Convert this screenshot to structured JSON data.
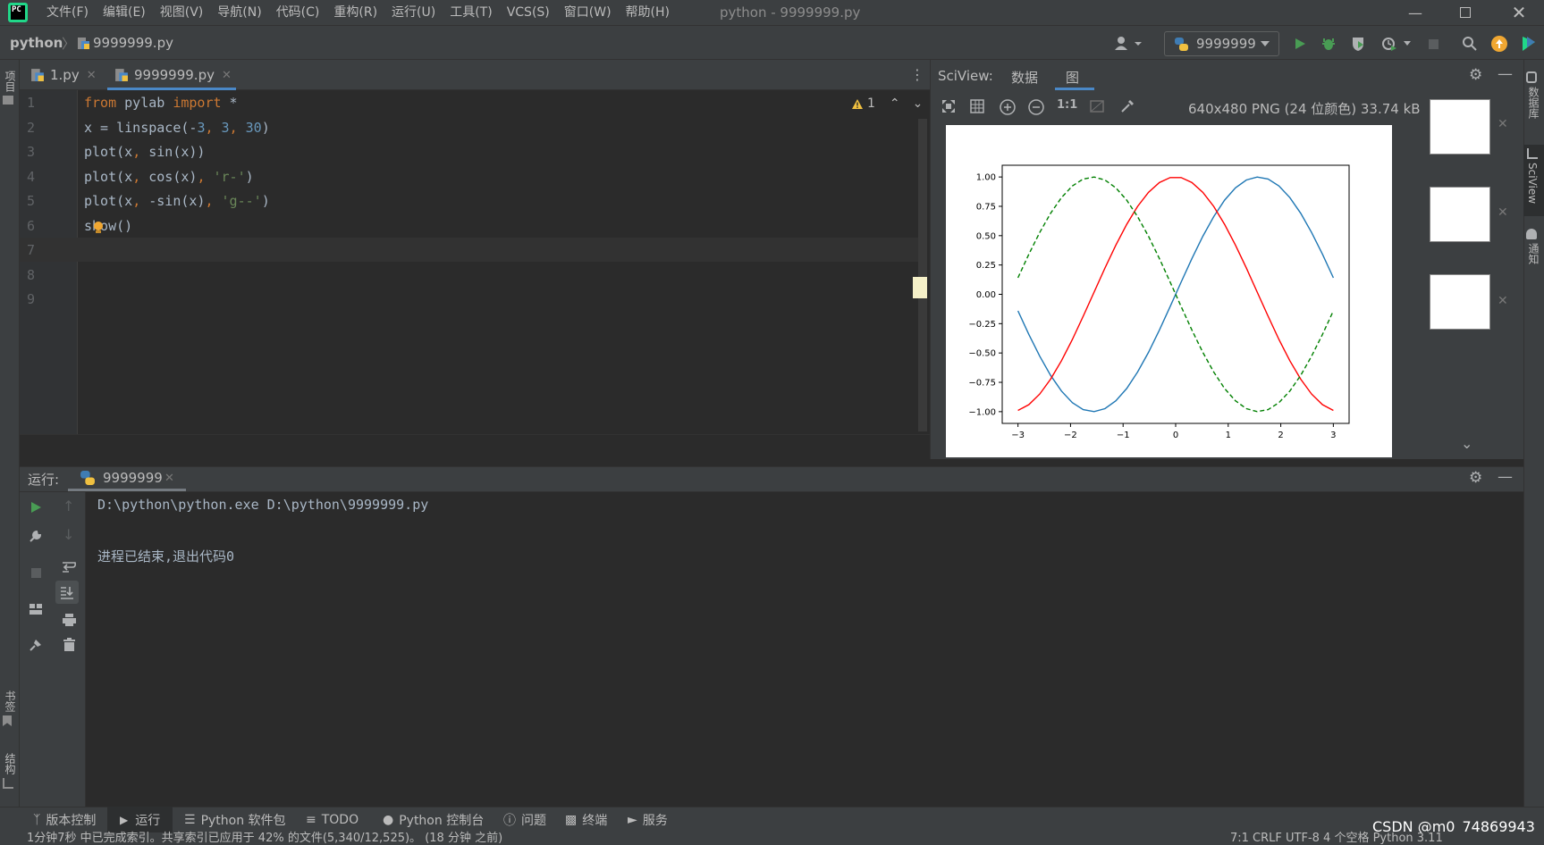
{
  "titlebar": {
    "menu": [
      "文件(F)",
      "编辑(E)",
      "视图(V)",
      "导航(N)",
      "代码(C)",
      "重构(R)",
      "运行(U)",
      "工具(T)",
      "VCS(S)",
      "窗口(W)",
      "帮助(H)"
    ],
    "title": "python - 9999999.py",
    "logo_text": "PC"
  },
  "navbar": {
    "project": "python",
    "file": "9999999.py",
    "run_config": "9999999"
  },
  "left_strip": {
    "project": "项目",
    "bookmarks": "书签",
    "structure": "结构"
  },
  "right_strip": {
    "database": "数据库",
    "sciview": "SciView",
    "notifications": "通知"
  },
  "editor": {
    "tabs": [
      {
        "label": "1.py",
        "active": false
      },
      {
        "label": "9999999.py",
        "active": true
      }
    ],
    "warning_count": "1",
    "line_numbers": [
      "1",
      "2",
      "3",
      "4",
      "5",
      "6",
      "7",
      "8",
      "9"
    ],
    "lines": [
      [
        {
          "t": "from",
          "c": "kw"
        },
        {
          "t": " pylab ",
          "c": "fn"
        },
        {
          "t": "import",
          "c": "kw"
        },
        {
          "t": " *",
          "c": "fn"
        }
      ],
      [
        {
          "t": "x = linspace(-",
          "c": "fn"
        },
        {
          "t": "3",
          "c": "num"
        },
        {
          "t": ", ",
          "c": "kw"
        },
        {
          "t": "3",
          "c": "num"
        },
        {
          "t": ", ",
          "c": "kw"
        },
        {
          "t": "30",
          "c": "num"
        },
        {
          "t": ")",
          "c": "fn"
        }
      ],
      [
        {
          "t": "plot(x",
          "c": "fn"
        },
        {
          "t": ", ",
          "c": "kw"
        },
        {
          "t": "sin(x))",
          "c": "fn"
        }
      ],
      [
        {
          "t": "plot(x",
          "c": "fn"
        },
        {
          "t": ", ",
          "c": "kw"
        },
        {
          "t": "cos(x)",
          "c": "fn"
        },
        {
          "t": ", ",
          "c": "kw"
        },
        {
          "t": "'r-'",
          "c": "str"
        },
        {
          "t": ")",
          "c": "fn"
        }
      ],
      [
        {
          "t": "plot(x",
          "c": "fn"
        },
        {
          "t": ", ",
          "c": "kw"
        },
        {
          "t": "-sin(x)",
          "c": "fn"
        },
        {
          "t": ", ",
          "c": "kw"
        },
        {
          "t": "'g--'",
          "c": "str"
        },
        {
          "t": ")",
          "c": "fn"
        }
      ],
      [
        {
          "t": "show()",
          "c": "fn"
        }
      ],
      [],
      [],
      []
    ]
  },
  "sciview": {
    "title": "SciView:",
    "tabs": [
      "数据",
      "图"
    ],
    "image_info": "640x480 PNG (24 位颜色) 33.74 kB",
    "zoom_label": "1:1"
  },
  "chart_data": {
    "type": "line",
    "title": "",
    "xlabel": "",
    "ylabel": "",
    "xlim": [
      -3.3,
      3.3
    ],
    "ylim": [
      -1.1,
      1.1
    ],
    "xticks": [
      "−3",
      "−2",
      "−1",
      "0",
      "1",
      "2",
      "3"
    ],
    "yticks": [
      "−1.00",
      "−0.75",
      "−0.50",
      "−0.25",
      "0.00",
      "0.25",
      "0.50",
      "0.75",
      "1.00"
    ],
    "x": "linspace(-3, 3, 30)",
    "series": [
      {
        "fn": "sin",
        "color": "#1f77b4",
        "style": "solid"
      },
      {
        "fn": "cos",
        "color": "#ff0000",
        "style": "solid"
      },
      {
        "fn": "-sin",
        "color": "#008000",
        "style": "dashed"
      }
    ],
    "grid": false
  },
  "run": {
    "label": "运行:",
    "tab": "9999999",
    "console": [
      "D:\\python\\python.exe D:\\python\\9999999.py",
      "",
      "进程已结束,退出代码0"
    ]
  },
  "bottom_tools": [
    "版本控制",
    "运行",
    "Python 软件包",
    "TODO",
    "Python 控制台",
    "问题",
    "终端",
    "服务"
  ],
  "status": {
    "left": "1分钟7秒 中已完成索引。共享索引已应用于 42% 的文件(5,340/12,525)。 (18 分钟 之前)",
    "right": "7:1   CRLF   UTF-8   4 个空格   Python 3.11"
  },
  "watermark": "CSDN @m0_74869943",
  "colors": {
    "accent": "#4a88c7",
    "run_green": "#499c54",
    "update_orange": "#f0a732"
  }
}
